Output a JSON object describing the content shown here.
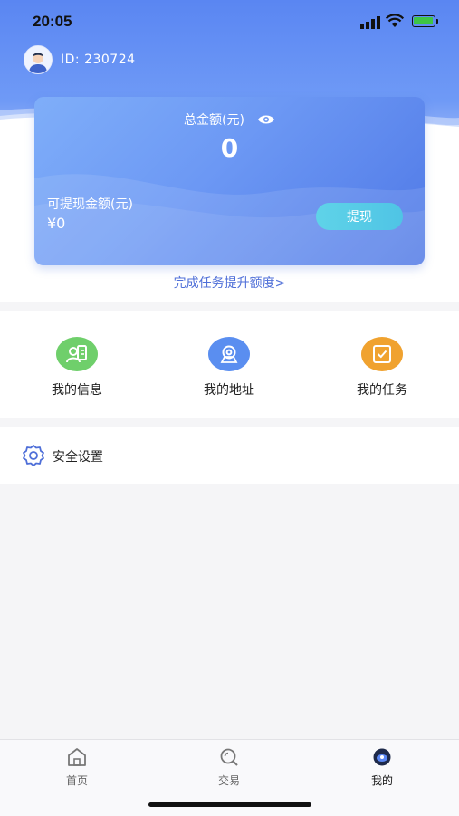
{
  "status_bar": {
    "time": "20:05"
  },
  "profile": {
    "id_text": "ID: 230724"
  },
  "balance_card": {
    "total_label": "总金额(元)",
    "total_value": "0",
    "available_label": "可提现金额(元)",
    "available_value": "¥0",
    "withdraw_label": "提现"
  },
  "upgrade_link": "完成任务提升额度>",
  "menu": {
    "items": [
      {
        "label": "我的信息",
        "icon": "user-card-icon",
        "color": "#6fcf6b"
      },
      {
        "label": "我的地址",
        "icon": "location-icon",
        "color": "#5a8ef0"
      },
      {
        "label": "我的任务",
        "icon": "task-icon",
        "color": "#f0a22f"
      }
    ]
  },
  "settings": {
    "label": "安全设置",
    "icon": "gear-icon"
  },
  "tabbar": {
    "tabs": [
      {
        "label": "首页",
        "icon": "home-icon",
        "active": false
      },
      {
        "label": "交易",
        "icon": "search-icon",
        "active": false
      },
      {
        "label": "我的",
        "icon": "profile-icon",
        "active": true
      }
    ]
  },
  "colors": {
    "accent": "#5a86f2",
    "card_button": "#56cbe6",
    "link": "#4f6fd8"
  }
}
